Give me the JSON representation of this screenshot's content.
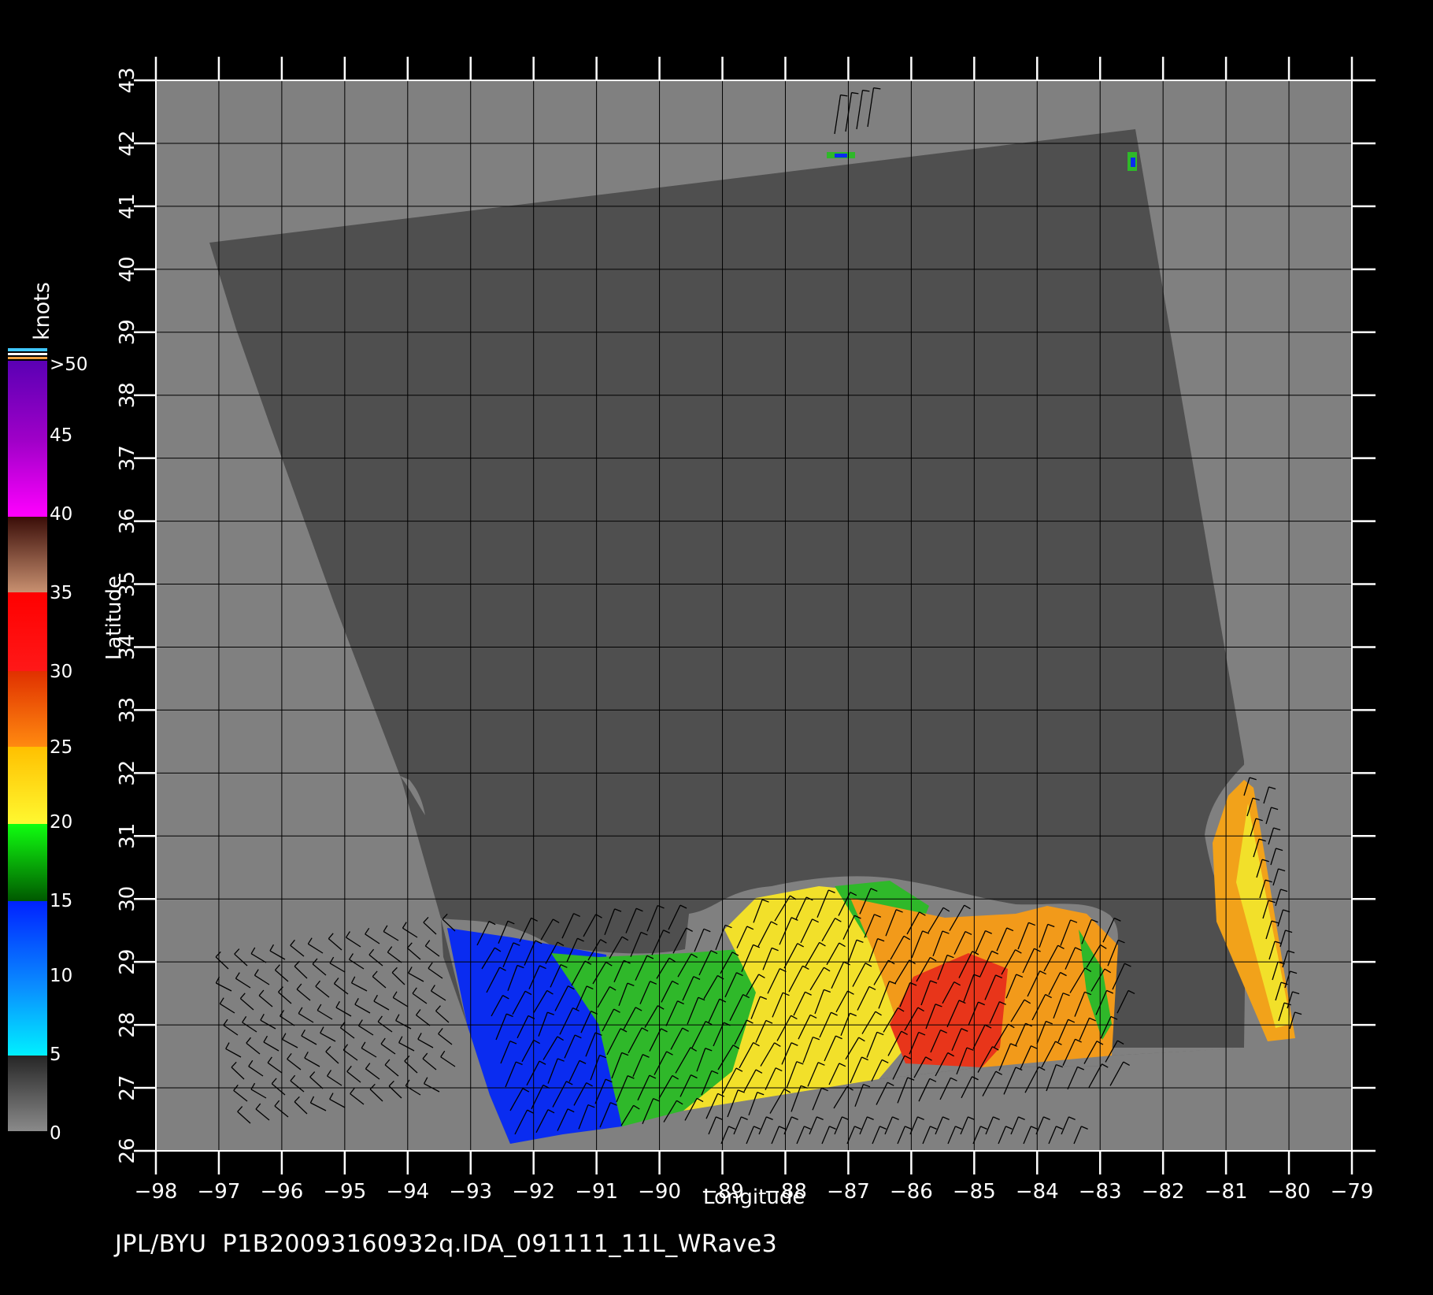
{
  "footer": "JPL/BYU  P1B20093160932q.IDA_091111_11L_WRave3",
  "colorbar": {
    "unit": "knots",
    "labels": [
      "0",
      "5",
      "10",
      "15",
      "20",
      "25",
      "30",
      "35",
      "40",
      "45",
      ">50"
    ]
  },
  "axes": {
    "xlabel": "Longitude",
    "ylabel": "Latitude",
    "x_ticks": [
      "-98",
      "-97",
      "-96",
      "-95",
      "-94",
      "-93",
      "-92",
      "-91",
      "-90",
      "-89",
      "-88",
      "-87",
      "-86",
      "-85",
      "-84",
      "-83",
      "-82",
      "-81",
      "-80",
      "-79"
    ],
    "y_ticks": [
      "26",
      "27",
      "28",
      "29",
      "30",
      "31",
      "32",
      "33",
      "34",
      "35",
      "36",
      "37",
      "38",
      "39",
      "40",
      "41",
      "42",
      "43"
    ]
  },
  "map": {
    "lon_range": [
      -98,
      -79
    ],
    "lat_range": [
      26,
      43
    ],
    "colors": {
      "land": "#808080",
      "swath": "#4f4f4f",
      "grid": "#000000",
      "frame": "#ffffff",
      "blue": "#0a2cf0",
      "green": "#2fb82a",
      "yellow": "#f2e02a",
      "orange": "#f29a1a",
      "red": "#e8351a"
    }
  }
}
